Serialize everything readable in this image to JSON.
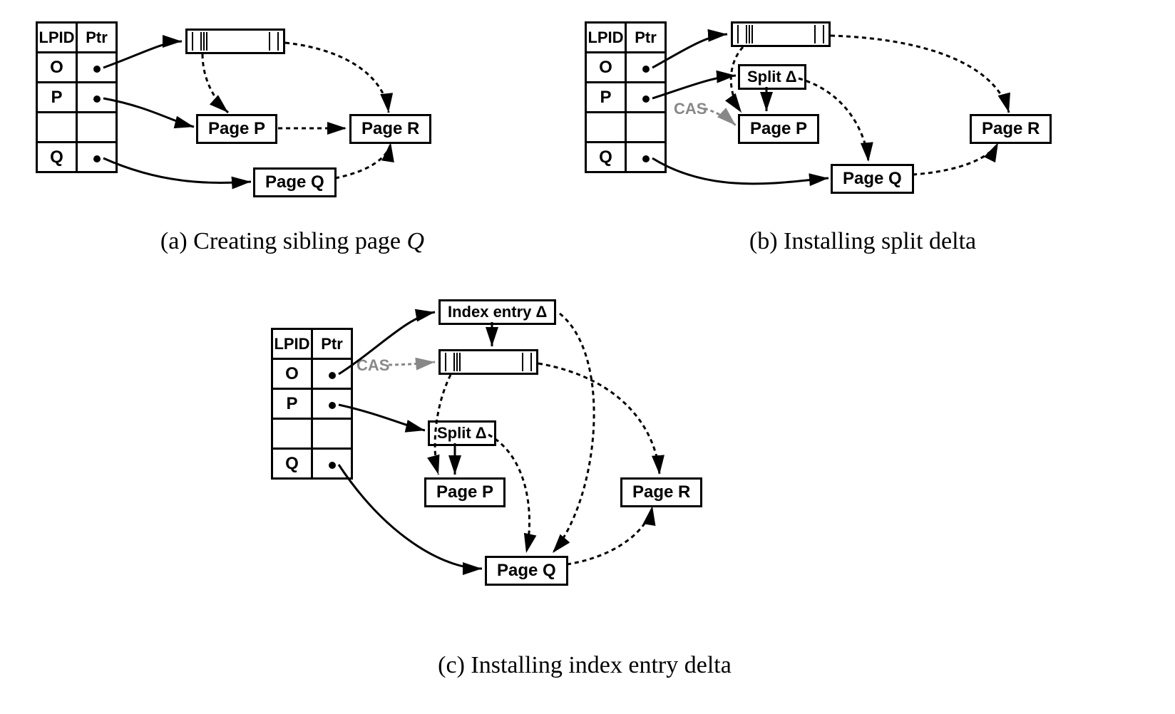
{
  "subfigures": {
    "a": {
      "caption_prefix": "(a) ",
      "caption_text": "Creating sibling page ",
      "caption_ital": "Q"
    },
    "b": {
      "caption_prefix": "(b) ",
      "caption_text": "Installing split delta",
      "caption_ital": ""
    },
    "c": {
      "caption_prefix": "(c) ",
      "caption_text": "Installing index entry delta",
      "caption_ital": ""
    }
  },
  "table_headers": {
    "col1": "LPID",
    "col2": "Ptr"
  },
  "table_rows": [
    "O",
    "P",
    "",
    "Q"
  ],
  "boxes": {
    "pageP": "Page P",
    "pageQ": "Page Q",
    "pageR": "Page R",
    "splitDelta": "Split Δ",
    "indexEntryDelta": "Index entry Δ"
  },
  "cas_label": "CAS"
}
